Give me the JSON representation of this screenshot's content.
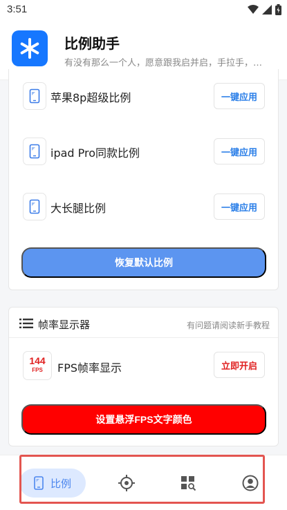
{
  "status_bar": {
    "time": "3:51",
    "icons": [
      "wifi-icon",
      "signal-icon",
      "battery-icon"
    ]
  },
  "header": {
    "logo_icon": "asterisk-logo-icon",
    "title": "比例助手",
    "subtitle": "有没有那么一个人，愿意跟我启并启，手拉手，…"
  },
  "ratio_card": {
    "items": [
      {
        "label": "苹果8p超级比例",
        "button": "一键应用"
      },
      {
        "label": "ipad Pro同款比例",
        "button": "一键应用"
      },
      {
        "label": "大长腿比例",
        "button": "一键应用"
      }
    ],
    "restore_button": "恢复默认比例"
  },
  "fps_card": {
    "title": "帧率显示器",
    "help_link": "有问题请阅读新手教程",
    "item_icon_number": "144",
    "item_icon_text": "FPS",
    "item_label": "FPS帧率显示",
    "item_button": "立即开启",
    "color_button": "设置悬浮FPS文字颜色"
  },
  "bottom_nav": {
    "items": [
      {
        "label": "比例",
        "icon": "phone-icon",
        "active": true
      },
      {
        "label": "",
        "icon": "crosshair-icon",
        "active": false
      },
      {
        "label": "",
        "icon": "grid-search-icon",
        "active": false
      },
      {
        "label": "",
        "icon": "user-icon",
        "active": false
      }
    ]
  },
  "colors": {
    "primary": "#1677ff",
    "restore": "#5c95f0",
    "fps_red": "#ff0000",
    "nav_active_bg": "#dde9ff",
    "highlight_frame": "#e35550"
  }
}
